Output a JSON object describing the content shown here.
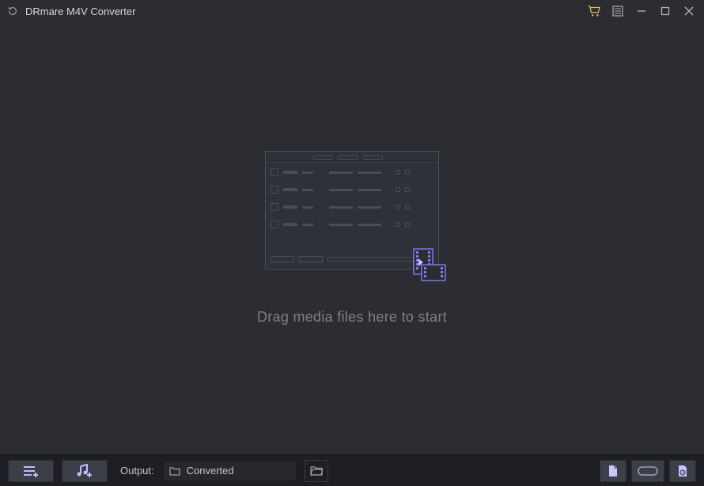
{
  "titlebar": {
    "title": "DRmare M4V Converter"
  },
  "main": {
    "drop_caption": "Drag media files here to start"
  },
  "bottombar": {
    "output_label": "Output:",
    "output_path": "Converted"
  },
  "icons": {
    "logo": "refresh-circle",
    "cart": "shopping-cart",
    "menu": "menu-list",
    "minimize": "minimize",
    "maximize": "maximize",
    "close": "close",
    "add_list": "add-list",
    "add_music": "add-music",
    "folder_sm": "folder",
    "folder_open": "folder-open",
    "output_file": "file",
    "output_format": "format",
    "output_history": "history"
  },
  "colors": {
    "accent_cart": "#e0c04a",
    "accent_indigo": "#7a7dff",
    "bg": "#2b2d32",
    "bottombar": "#1e1f23",
    "btn": "#3c3f48",
    "text_dim": "#7d8089"
  }
}
